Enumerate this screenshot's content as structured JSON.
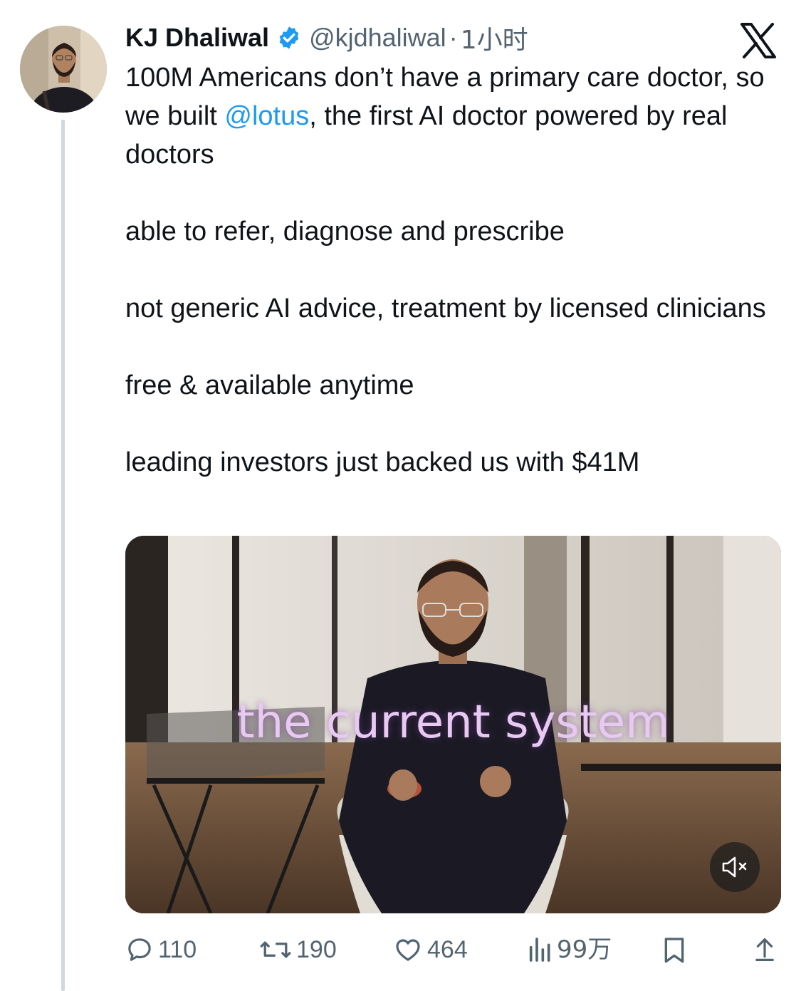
{
  "author": {
    "display_name": "KJ Dhaliwal",
    "handle": "@kjdhaliwal",
    "separator": "·",
    "time": "1小时"
  },
  "tweet": {
    "line1_pre": "100M Americans don’t have a primary care doctor, so we built ",
    "mention": "@lotus",
    "line1_post": ", the first AI doctor powered by real doctors",
    "para2": "able to refer, diagnose and prescribe",
    "para3": "not generic AI advice, treatment by licensed clinicians",
    "para4": "free & available anytime",
    "para5": "leading investors just backed us with $41M"
  },
  "media": {
    "caption": "the current system"
  },
  "actions": {
    "replies": "110",
    "reposts": "190",
    "likes": "464",
    "views": "99万"
  },
  "colors": {
    "accent": "#1d9bf0",
    "secondary_text": "#536471",
    "verified": "#1d9bf0"
  }
}
